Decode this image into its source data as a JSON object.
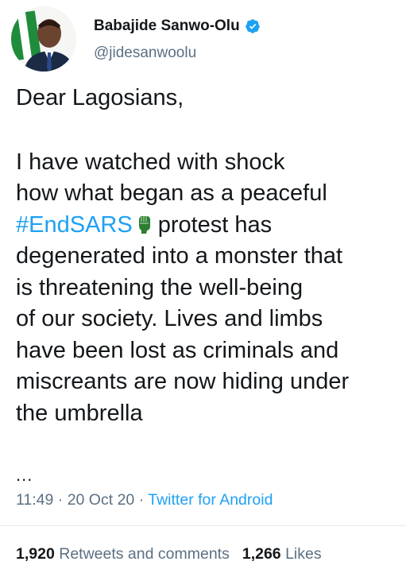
{
  "author": {
    "display_name": "Babajide Sanwo-Olu",
    "handle": "@jidesanwoolu",
    "verified": true,
    "avatar_icon": "profile-photo"
  },
  "tweet": {
    "greeting": "Dear Lagosians,",
    "line1": "I have watched with shock",
    "line2": "how what began as a peaceful",
    "hashtag": "#EndSARS",
    "emoji_icon": "raised-fist-emoji",
    "line3_rest": "protest has",
    "line4": "degenerated into a monster that",
    "line5": "is threatening the well-being",
    "line6": "of our society. Lives and limbs",
    "line7": "have been lost as criminals and",
    "line8": "miscreants are now hiding under",
    "line9": "the umbrella",
    "ellipsis": "..."
  },
  "meta": {
    "time": "11:49",
    "date": "20 Oct 20",
    "separator": "·",
    "source": "Twitter for Android"
  },
  "stats": {
    "retweets_count": "1,920",
    "retweets_label": "Retweets and comments",
    "likes_count": "1,266",
    "likes_label": "Likes"
  },
  "colors": {
    "link": "#1da1f2",
    "secondary_text": "#5b7083",
    "primary_text": "#14171a",
    "verified_badge": "#1da1f2"
  }
}
